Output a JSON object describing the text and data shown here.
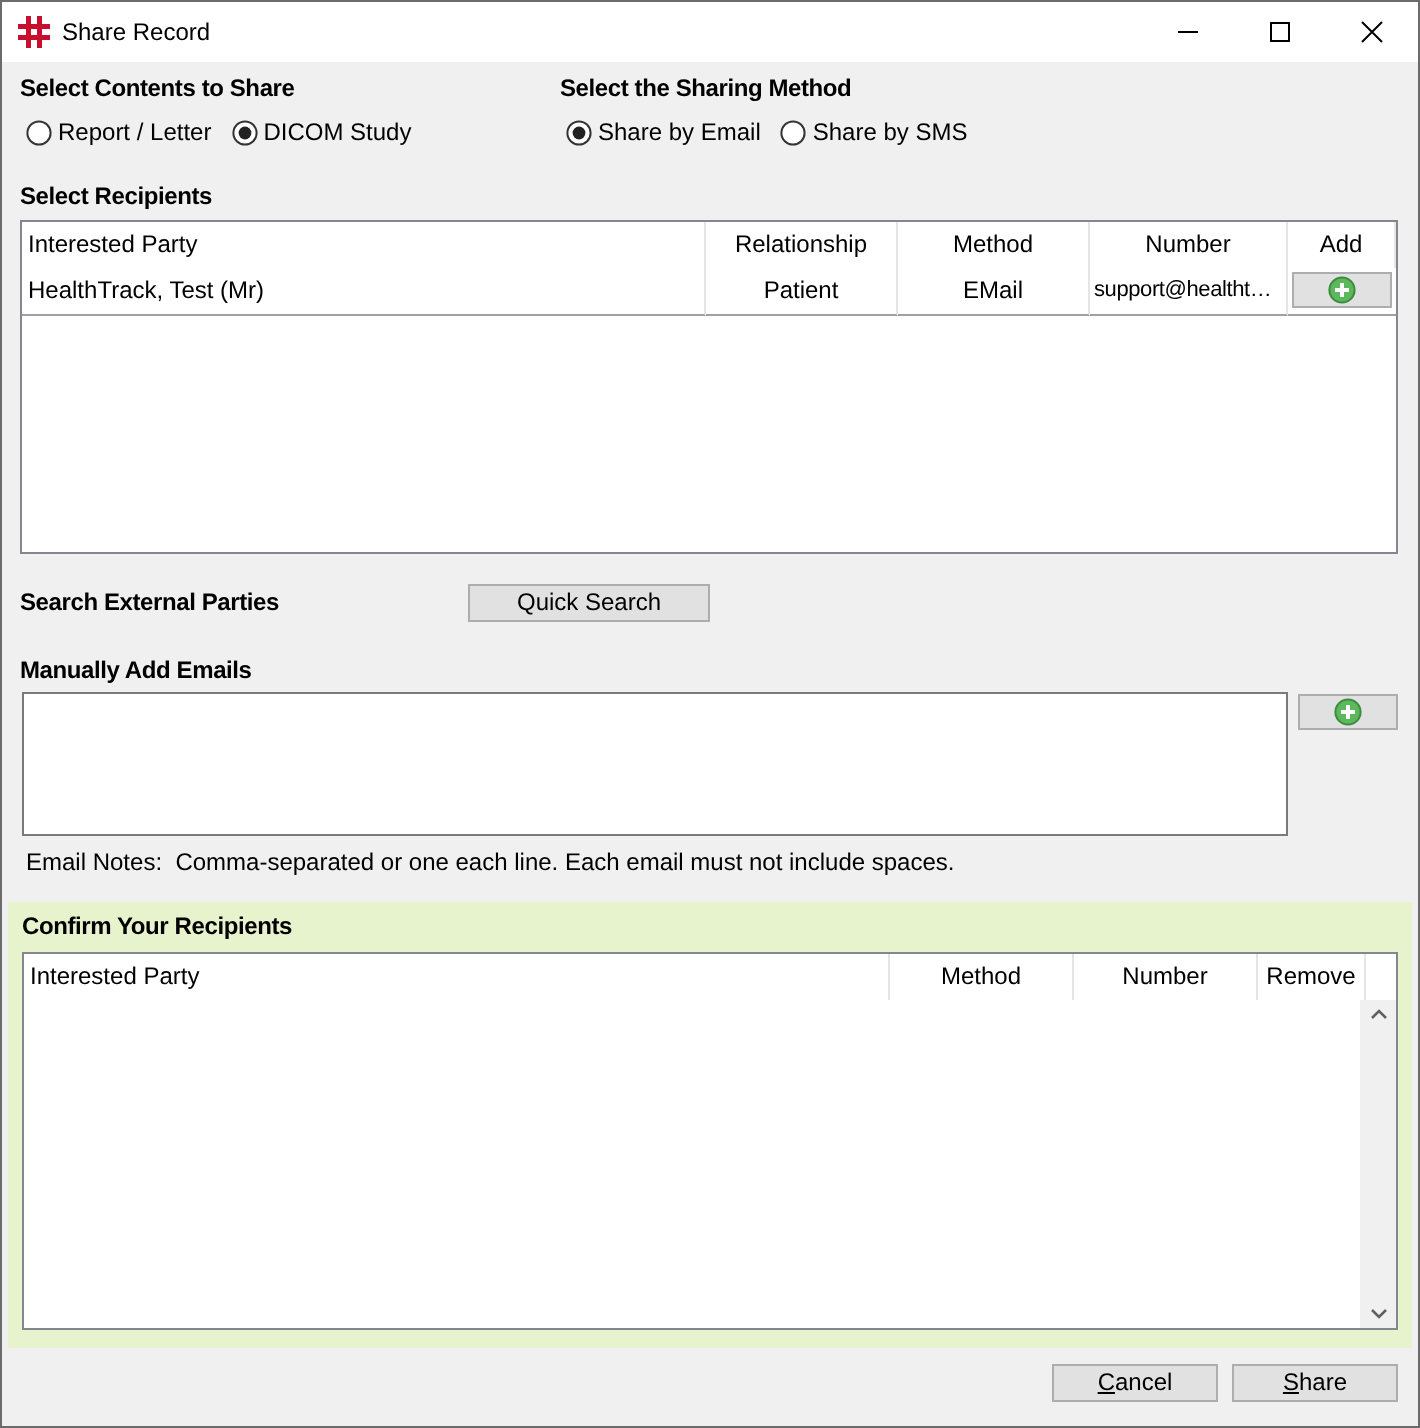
{
  "window": {
    "title": "Share Record"
  },
  "contents": {
    "heading": "Select Contents to Share",
    "options": [
      {
        "label": "Report / Letter",
        "selected": false
      },
      {
        "label": "DICOM Study",
        "selected": true
      }
    ]
  },
  "method": {
    "heading": "Select the Sharing Method",
    "options": [
      {
        "label": "Share by Email",
        "selected": true
      },
      {
        "label": "Share by SMS",
        "selected": false
      }
    ]
  },
  "recipients": {
    "heading": "Select Recipients",
    "columns": [
      "Interested Party",
      "Relationship",
      "Method",
      "Number",
      "Add"
    ],
    "rows": [
      {
        "party": "HealthTrack, Test (Mr)",
        "relationship": "Patient",
        "method": "EMail",
        "number": "support@healtht…"
      }
    ]
  },
  "search": {
    "label": "Search External Parties",
    "button": "Quick Search"
  },
  "manual": {
    "heading": "Manually Add Emails",
    "notes": "Email Notes:  Comma-separated or one each line. Each email must not include spaces."
  },
  "confirm": {
    "heading": "Confirm Your Recipients",
    "columns": [
      "Interested Party",
      "Method",
      "Number",
      "Remove"
    ]
  },
  "buttons": [
    {
      "label": "Cancel",
      "underline_first": true
    },
    {
      "label": "Share",
      "underline_first": true
    }
  ]
}
